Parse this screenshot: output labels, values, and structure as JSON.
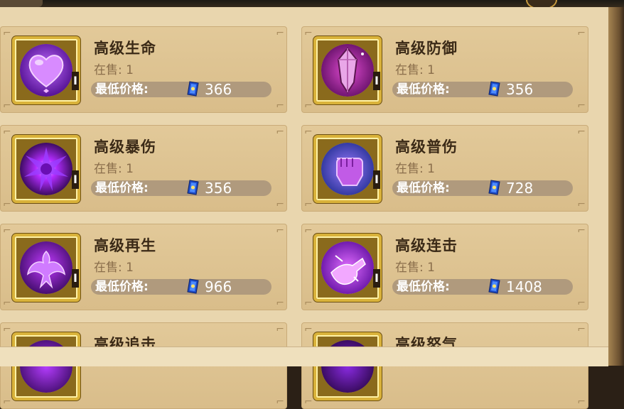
{
  "items": [
    {
      "name": "高级生命",
      "on_sale": "在售: 1",
      "price_label": "最低价格:",
      "price": "366",
      "icon": "purple-heart-icon",
      "level_mark": "I"
    },
    {
      "name": "高级防御",
      "on_sale": "在售: 1",
      "price_label": "最低价格:",
      "price": "356",
      "icon": "crystal-shield-icon",
      "level_mark": "I"
    },
    {
      "name": "高级暴伤",
      "on_sale": "在售: 1",
      "price_label": "最低价格:",
      "price": "356",
      "icon": "burst-icon",
      "level_mark": "I"
    },
    {
      "name": "高级普伤",
      "on_sale": "在售: 1",
      "price_label": "最低价格:",
      "price": "728",
      "icon": "fist-icon",
      "level_mark": "I"
    },
    {
      "name": "高级再生",
      "on_sale": "在售: 1",
      "price_label": "最低价格:",
      "price": "966",
      "icon": "phoenix-icon",
      "level_mark": "I"
    },
    {
      "name": "高级连击",
      "on_sale": "在售: 1",
      "price_label": "最低价格:",
      "price": "1408",
      "icon": "combo-punch-icon",
      "level_mark": "I"
    },
    {
      "name": "高级追击",
      "icon": "pursuit-icon"
    },
    {
      "name": "高级怒气",
      "icon": "rage-icon"
    }
  ],
  "colors": {
    "panel": "#e9d6ae",
    "card": "#dcc08e",
    "gold_frame": "#d9b23a",
    "title_text": "#3b2a17",
    "subtext": "#8a6e4b",
    "price_bar": "#b09a7d",
    "orb_purple": "#7a1ec7"
  },
  "currency_icon": "blue-card-gem-icon"
}
